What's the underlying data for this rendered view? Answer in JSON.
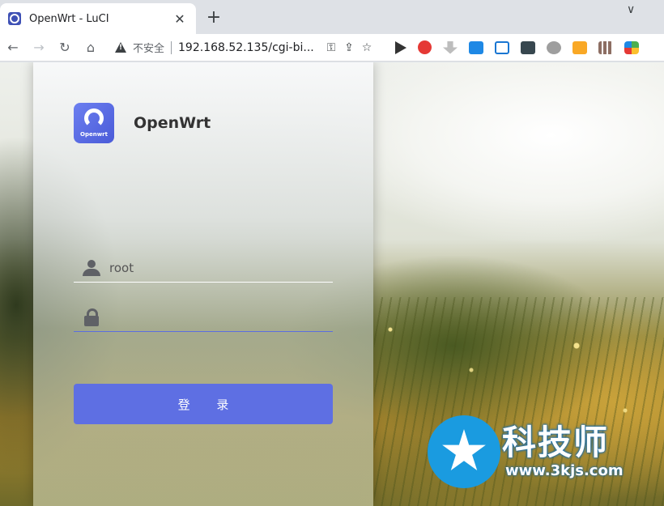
{
  "browser": {
    "tab_title": "OpenWrt - LuCI",
    "tab_close": "✕",
    "new_tab": "+",
    "window_chevron": "∨",
    "security_label": "不安全",
    "url": "192.168.52.135/cgi-bi...",
    "nav": {
      "back": "←",
      "forward": "→",
      "reload": "↻",
      "home": "⌂"
    },
    "omnibox_icons": [
      "key-icon",
      "share-icon",
      "star-icon"
    ],
    "extensions": [
      "play-extension-icon",
      "adblock-plus-icon",
      "download-extension-icon",
      "blue-extension-icon",
      "document-extension-icon",
      "dark-extension-icon",
      "gear-extension-icon",
      "yellow-extension-icon",
      "grid-extension-icon",
      "multicolor-extension-icon"
    ]
  },
  "login": {
    "logo_text": "Openwrt",
    "brand": "OpenWrt",
    "username_value": "root",
    "password_value": "",
    "login_button": "登 录",
    "accent_color": "#5e6fe3"
  },
  "watermark": {
    "title": "科技师",
    "url": "www.3kjs.com"
  }
}
